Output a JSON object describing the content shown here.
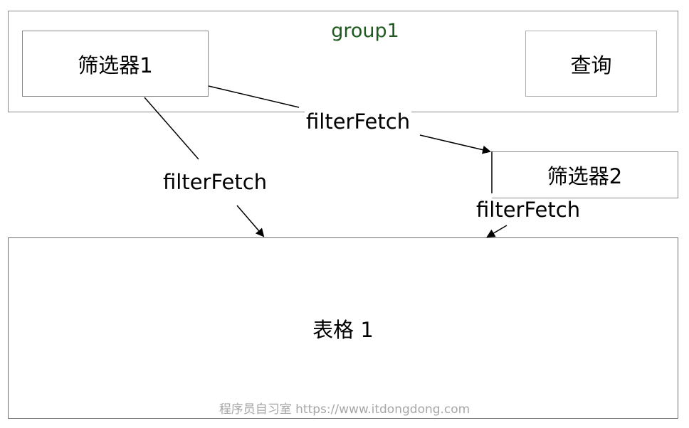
{
  "group": {
    "title": "group1"
  },
  "nodes": {
    "filter1": "筛选器1",
    "query": "查询",
    "filter2": "筛选器2",
    "table1": "表格 1"
  },
  "edges": {
    "label1": "filterFetch",
    "label2": "filterFetch",
    "label3": "filterFetch"
  },
  "watermark": "程序员自习室 https://www.itdongdong.com",
  "colors": {
    "group_title": "#1e5a1e",
    "border": "#8a8a8a",
    "watermark": "#a6a6a6"
  }
}
